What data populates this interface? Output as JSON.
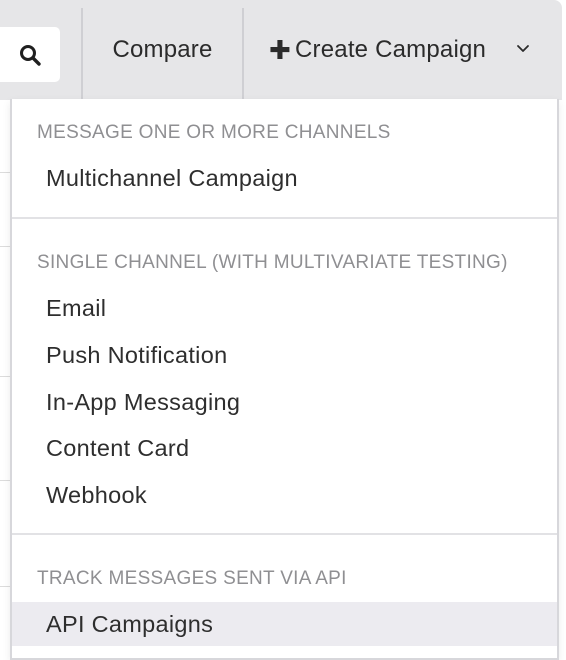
{
  "toolbar": {
    "compare_label": "Compare",
    "create_label": "Create Campaign",
    "search_icon": "search-icon",
    "plus_icon": "plus-icon",
    "chevron_icon": "chevron-down-icon"
  },
  "menu": {
    "sections": [
      {
        "header": "MESSAGE ONE OR MORE CHANNELS",
        "items": [
          "Multichannel Campaign"
        ]
      },
      {
        "header": "SINGLE CHANNEL (WITH MULTIVARIATE TESTING)",
        "items": [
          "Email",
          "Push Notification",
          "In-App Messaging",
          "Content Card",
          "Webhook"
        ]
      },
      {
        "header": "TRACK MESSAGES SENT VIA API",
        "items": [
          "API Campaigns"
        ]
      }
    ],
    "highlighted_item": "API Campaigns"
  },
  "colors": {
    "toolbar_bg": "#e6e6e8",
    "header_text": "#8f8f92",
    "highlight_bg": "#ecebf0"
  }
}
